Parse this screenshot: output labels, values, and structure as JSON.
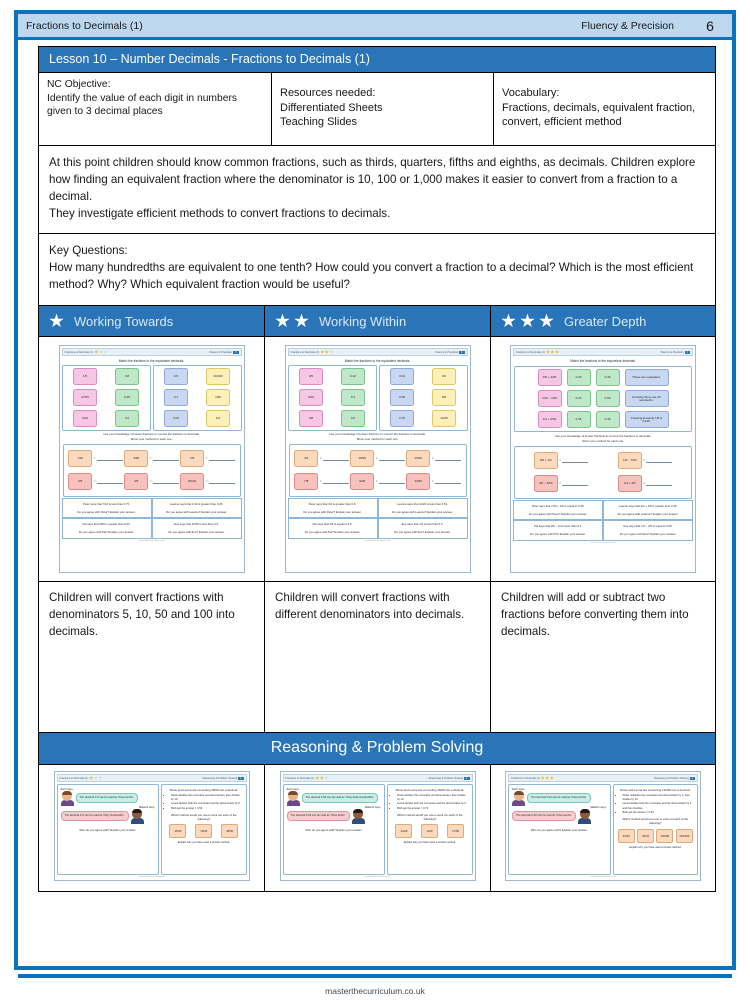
{
  "header": {
    "left_title": "Fractions to Decimals (1)",
    "right_title": "Fluency & Precision",
    "page_number": "6"
  },
  "lesson": {
    "title": "Lesson 10 – Number Decimals - Fractions to Decimals (1)"
  },
  "info": {
    "nc_objective_label": "NC Objective:",
    "nc_objective_text": "Identify the value of each digit in numbers given to 3 decimal places",
    "resources_label": "Resources needed:",
    "resources_items": "Differentiated Sheets\nTeaching Slides",
    "vocabulary_label": "Vocabulary:",
    "vocabulary_text": "Fractions, decimals, equivalent fraction, convert, efficient method"
  },
  "overview": {
    "line1": "At this point children should know common fractions, such as thirds, quarters, fifths and eighths, as decimals. Children explore how finding an equivalent fraction where the denominator is 10, 100 or 1,000 makes it easier to convert from a fraction to a decimal.",
    "line2": "They investigate efficient methods to convert fractions to decimals."
  },
  "key_questions": {
    "label": "Key Questions:",
    "text": "How many hundredths are equivalent to one tenth? How could you convert a fraction to a decimal? Which is the most efficient method? Why? Which equivalent fraction would be useful?"
  },
  "differentiation": {
    "columns": [
      {
        "stars": 1,
        "label": "Working Towards",
        "description": "Children will convert fractions with denominators 5, 10, 50 and 100 into decimals."
      },
      {
        "stars": 2,
        "label": "Working Within",
        "description": "Children will convert fractions with different denominators into decimals."
      },
      {
        "stars": 3,
        "label": "Greater Depth",
        "description": "Children will add or subtract two fractions before converting them into decimals."
      }
    ]
  },
  "reasoning": {
    "banner": "Reasoning & Problem Solving"
  },
  "worksheets": [
    {
      "doc_title": "Fractions to Decimals (1)",
      "doc_tag": "Fluency & Precision",
      "page": "1",
      "stars": 1,
      "instruction": "Match the fractions to the equivalent decimals.",
      "match_left_fracs": [
        "1/5",
        "27/50",
        "9/10"
      ],
      "match_left_decs": [
        "0.8",
        "0.25",
        "0.2"
      ],
      "match_right_decs": [
        "0.5",
        "0.1",
        "0.04"
      ],
      "match_right_fracs": [
        "30/100",
        "1/50",
        "1/2"
      ],
      "convert_instruction_1": "Use your knowledge of known fractions to convert the fractions to decimals.",
      "convert_instruction_2": "Show your method for each one.",
      "convert_items": [
        "7/10",
        "3/50",
        "2/5",
        "3/5",
        "4/5",
        "8/100"
      ],
      "questions": [
        "Peter says that 7/10 is less than 0.75.",
        "Leanne says that 1/10 is greater than 0.25.",
        "Pia says that 3/50 is greater than 0.04.",
        "Eve says that 11/50 is less than 0.6."
      ],
      "prompts": [
        "Do you agree with Peter? Explain your answer.",
        "Do you agree with Leanne? Explain your answer.",
        "Do you agree with Pia? Explain your answer.",
        "Do you agree with Eve? Explain your answer."
      ]
    },
    {
      "doc_title": "Fractions to Decimals (1)",
      "doc_tag": "Fluency & Precision",
      "page": "1",
      "stars": 2,
      "instruction": "Match the fractions to the equivalent decimals.",
      "match_left_fracs": [
        "4/5",
        "9/20",
        "4/8"
      ],
      "match_left_decs": [
        "0.32",
        "0.3",
        "0.5"
      ],
      "match_right_decs": [
        "0.04",
        "0.08",
        "0.75"
      ],
      "match_right_fracs": [
        "3/4",
        "6/8",
        "12/25"
      ],
      "convert_instruction_1": "Use your knowledge of known fractions to convert the fractions to decimals.",
      "convert_instruction_2": "Show your method for each one.",
      "convert_items": [
        "3/4",
        "18/25",
        "15/20",
        "7/8",
        "9/20",
        "13/50"
      ],
      "questions": [
        "Peter says that 3/4 is greater than 0.8.",
        "Leanne says that 11/20 is less than 0.53.",
        "Pia says that 4/8 is equal to 0.5.",
        "Eve says that 1/4 is less than 0.3."
      ],
      "prompts": [
        "Do you agree with Peter? Explain your answer.",
        "Do you agree with Leanne? Explain your answer.",
        "Do you agree with Pia? Explain your answer.",
        "Do you agree with Eve? Explain your answer."
      ]
    },
    {
      "doc_title": "Fractions to Decimals (1)",
      "doc_tag": "Fluency & Precision",
      "page": "1",
      "stars": 3,
      "instruction": "Match the fractions to the equivalent decimals.",
      "gd_rows": [
        {
          "expr": "3/5 + 4/25",
          "dec1": "0.29",
          "dec2": "0.46",
          "note": "These are equivalent."
        },
        {
          "expr": "7/20 – 1/50",
          "dec1": "0.23",
          "dec2": "0.53",
          "note": "Knowing there are 20 twentieths."
        },
        {
          "expr": "1/4 + 9/50",
          "dec1": "0.66",
          "dec2": "0.46",
          "note": "Knowing knowing 1/8 is 0.125."
        }
      ],
      "convert_instruction_1": "Use your knowledge of known fractions to convert the fractions to decimals.",
      "convert_instruction_2": "Show your method for each one.",
      "convert_items": [
        "3/5 + 1/4",
        "1/2 – 7/20",
        "4/5 – 3/50",
        "1/4 + 3/5"
      ],
      "questions": [
        "Peter says that 7/20 + 1/5 is equal to 0.45.",
        "Leanne says that 3/4 + 1/8 is greater than 0.45.",
        "Pia says that 3/5 – 1/4 is less than 0.4.",
        "Eve says that 1/2 – 2/5 is equal to 0.05."
      ],
      "prompts": [
        "Do you agree with Peter? Explain your answer.",
        "Do you agree with Leanne? Explain your answer.",
        "Do you agree with Pia? Explain your answer.",
        "Do you agree with Eve? Explain your answer."
      ]
    }
  ],
  "reasoning_sheets": [
    {
      "doc_title": "Fractions to Decimals (1)",
      "doc_tag": "Reasoning & Problem Solving",
      "page": "1",
      "stars": 1,
      "speaker1": "Zach says,",
      "bubble1": "The decimal 0.3 can be read as ‘three tenths’.",
      "speaker2": "Malachi says,",
      "bubble2": "The decimal 0.3 can be read as ‘thirty hundredths’.",
      "who_prompt": "Who do you agree with? Explain your answer.",
      "right_title": "Rosie and Leona are converting 28/50 into a decimal.",
      "bullets": [
        "Rosie doubles the numerator and denominator, then divides by 10.",
        "Leona divides both the numerator and the denominator by 5.",
        "Both get the answer = 0.56."
      ],
      "right_q": "Which method would you use to work out each of the following?",
      "cards": [
        "46/50",
        "16/25",
        "48/50"
      ],
      "explain": "Explain why you have used a certain method."
    },
    {
      "doc_title": "Fractions to Decimals (1)",
      "doc_tag": "Reasoning & Problem Solving",
      "page": "1",
      "stars": 2,
      "speaker1": "Zach says,",
      "bubble1": "The decimal 0.33 can be read as ‘thirty-three hundredths’.",
      "speaker2": "Malachi says,",
      "bubble2": "The decimal 0.33 can be read as ‘three thirds’.",
      "who_prompt": "Who do you agree with? Explain your answer.",
      "right_title": "Rosie and Leona are converting 18/25 into a decimal.",
      "bullets": [
        "Rosie doubles the numerator and denominator, then divides by 10.",
        "Leona divides both the numerator and the denominator by 5.",
        "Both get the answer = 0.72."
      ],
      "right_q": "Which method would you use to work out each of the following?",
      "cards": [
        "14/25",
        "9/20",
        "17/50"
      ],
      "explain": "Explain why you have used a certain method."
    },
    {
      "doc_title": "Fractions to Decimals (1)",
      "doc_tag": "Reasoning & Problem Solving",
      "page": "1",
      "stars": 3,
      "speaker1": "Zach says,",
      "bubble1": "The decimal 0.33 can be read as ‘three tenths’.",
      "speaker2": "Malachi says,",
      "bubble2": "The decimal 0.33 can be read as ‘three tenths’.",
      "who_prompt": "Who do you agree with? Explain your answer.",
      "right_title": "Rosie and Leona are converting 13/250 into a decimal.",
      "bullets": [
        "Rosie multiplies the numerator and denominator by 4, then divides by 10.",
        "Leona divides both the numerator and the denominator by 5 and then doubles.",
        "Both get the answer = 0.56."
      ],
      "right_q": "Which method would you use to work out each of the following?",
      "cards": [
        "46/50",
        "26/25",
        "49/250",
        "160/250"
      ],
      "explain": "Explain why you have used a certain method."
    }
  ],
  "footer": {
    "text": "masterthecurriculum.co.uk"
  }
}
